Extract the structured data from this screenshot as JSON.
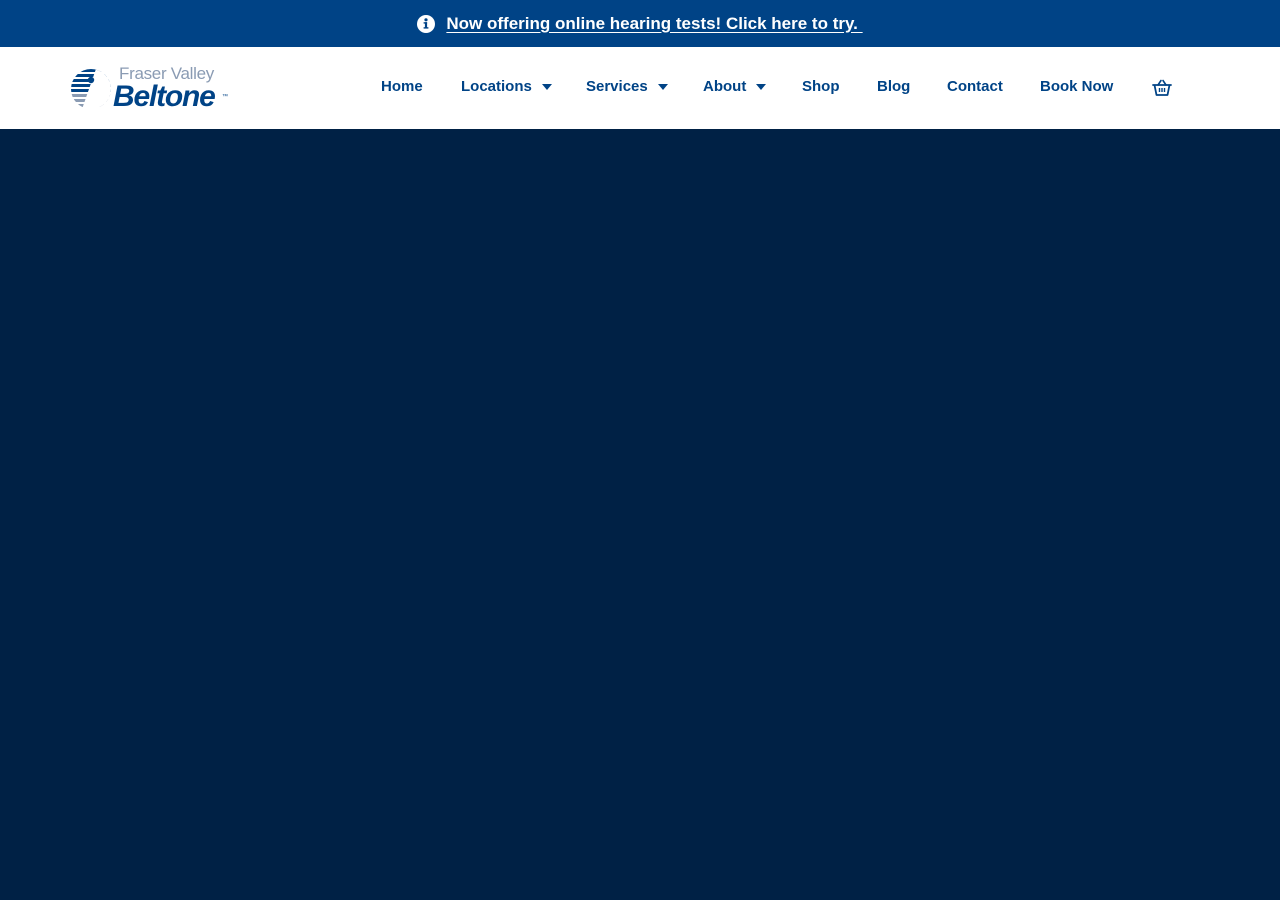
{
  "announcement": {
    "icon": "info-icon",
    "text": "Now offering online hearing tests! Click here to try. "
  },
  "logo": {
    "line1": "Fraser Valley",
    "line2": "Beltone",
    "trademark": "™"
  },
  "nav": {
    "items": [
      {
        "label": "Home"
      },
      {
        "label": "Locations"
      },
      {
        "label": "Services"
      },
      {
        "label": "About"
      },
      {
        "label": "Shop"
      },
      {
        "label": "Blog"
      },
      {
        "label": "Contact"
      },
      {
        "label": "Book Now"
      }
    ],
    "cart_icon": "basket-icon"
  },
  "colors": {
    "announcement_bg": "#004386",
    "brand_blue": "#004386",
    "hero_bg": "#002145",
    "logo_gray": "#8a9bb3",
    "header_bg": "#ffffff"
  }
}
